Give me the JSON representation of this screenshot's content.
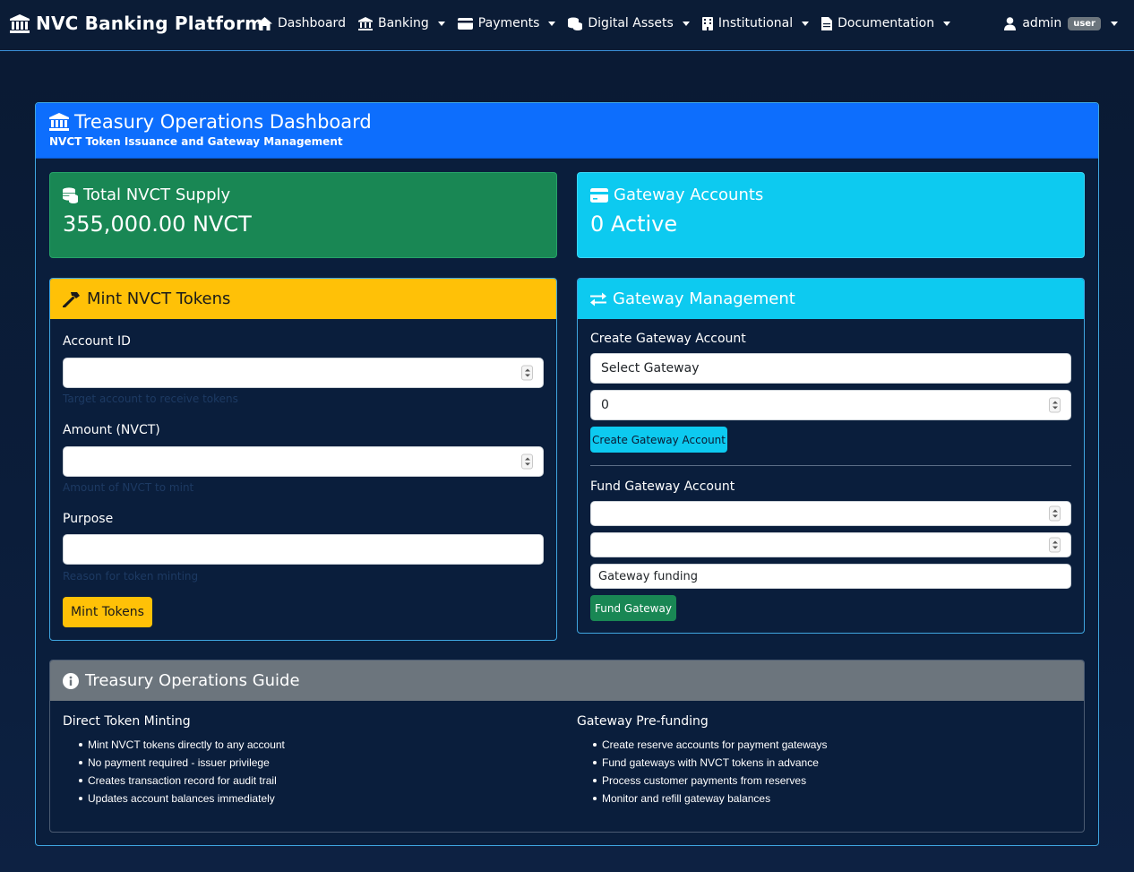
{
  "navbar": {
    "brand": "NVC Banking Platform",
    "items": [
      {
        "label": "Dashboard",
        "icon": "home-icon",
        "dropdown": false
      },
      {
        "label": "Banking",
        "icon": "bank-icon",
        "dropdown": true
      },
      {
        "label": "Payments",
        "icon": "credit-card-icon",
        "dropdown": true
      },
      {
        "label": "Digital Assets",
        "icon": "coins-icon",
        "dropdown": true
      },
      {
        "label": "Institutional",
        "icon": "building-icon",
        "dropdown": true
      },
      {
        "label": "Documentation",
        "icon": "file-icon",
        "dropdown": true
      }
    ],
    "user": {
      "name": "admin",
      "role_badge": "user"
    }
  },
  "dashboard": {
    "title": "Treasury Operations Dashboard",
    "subtitle": "NVCT Token Issuance and Gateway Management"
  },
  "stats": {
    "supply": {
      "label": "Total NVCT Supply",
      "value": "355,000.00 NVCT"
    },
    "gateways": {
      "label": "Gateway Accounts",
      "value": "0 Active"
    }
  },
  "mint": {
    "title": "Mint NVCT Tokens",
    "account_label": "Account ID",
    "account_value": "",
    "account_help": "Target account to receive tokens",
    "amount_label": "Amount (NVCT)",
    "amount_value": "",
    "amount_help": "Amount of NVCT to mint",
    "purpose_label": "Purpose",
    "purpose_value": "",
    "purpose_help": "Reason for token minting",
    "button": "Mint Tokens"
  },
  "gateway": {
    "title": "Gateway Management",
    "create_label": "Create Gateway Account",
    "select_value": "Select Gateway",
    "initial_value": "0",
    "create_button": "Create Gateway Account",
    "fund_label": "Fund Gateway Account",
    "fund_account_value": "",
    "fund_amount_value": "",
    "fund_purpose_value": "Gateway funding",
    "fund_button": "Fund Gateway"
  },
  "guide": {
    "title": "Treasury Operations Guide",
    "left": {
      "heading": "Direct Token Minting",
      "items": [
        "Mint NVCT tokens directly to any account",
        "No payment required - issuer privilege",
        "Creates transaction record for audit trail",
        "Updates account balances immediately"
      ]
    },
    "right": {
      "heading": "Gateway Pre-funding",
      "items": [
        "Create reserve accounts for payment gateways",
        "Fund gateways with NVCT tokens in advance",
        "Process customer payments from reserves",
        "Monitor and refill gateway balances"
      ]
    }
  },
  "colors": {
    "primary": "#0d6efd",
    "success": "#198754",
    "info": "#0dcaf0",
    "warning": "#ffc107",
    "secondary": "#6c757d",
    "background": "#0b1d3a"
  }
}
